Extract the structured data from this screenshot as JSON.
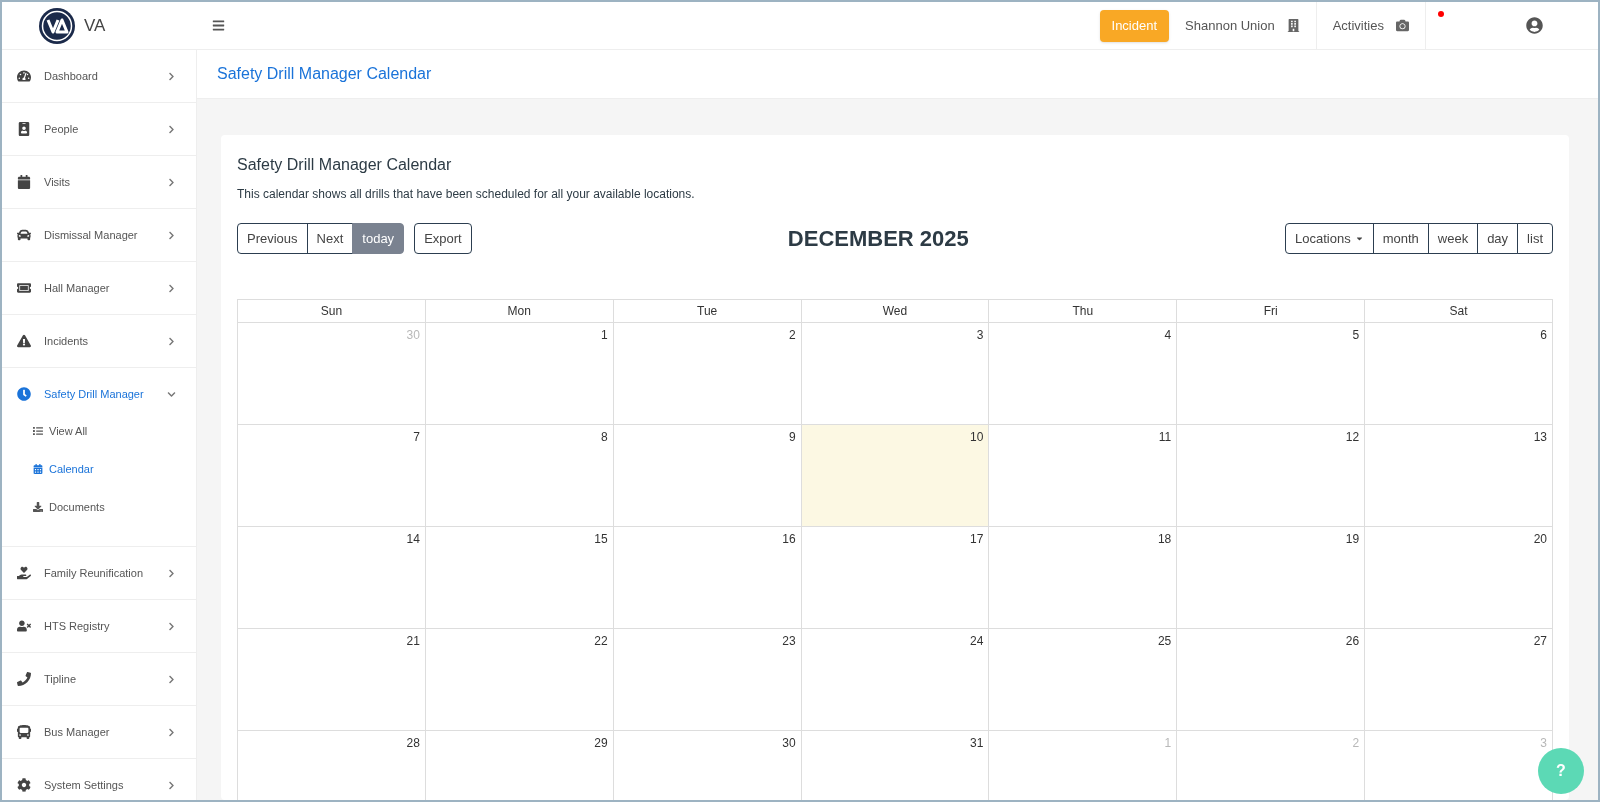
{
  "brand": {
    "name": "VA"
  },
  "topbar": {
    "incident_button": "Incident",
    "school": "Shannon Union",
    "activities": "Activities",
    "has_notification": true
  },
  "sidebar": {
    "items": [
      {
        "label": "Dashboard",
        "selected": false,
        "expanded": false
      },
      {
        "label": "People",
        "selected": false,
        "expanded": false
      },
      {
        "label": "Visits",
        "selected": false,
        "expanded": false
      },
      {
        "label": "Dismissal Manager",
        "selected": false,
        "expanded": false
      },
      {
        "label": "Hall Manager",
        "selected": false,
        "expanded": false
      },
      {
        "label": "Incidents",
        "selected": false,
        "expanded": false
      },
      {
        "label": "Safety Drill Manager",
        "selected": true,
        "expanded": true,
        "children": [
          {
            "label": "View All",
            "selected": false
          },
          {
            "label": "Calendar",
            "selected": true
          },
          {
            "label": "Documents",
            "selected": false
          }
        ]
      },
      {
        "label": "Family Reunification",
        "selected": false,
        "expanded": false
      },
      {
        "label": "HTS Registry",
        "selected": false,
        "expanded": false
      },
      {
        "label": "Tipline",
        "selected": false,
        "expanded": false
      },
      {
        "label": "Bus Manager",
        "selected": false,
        "expanded": false
      },
      {
        "label": "System Settings",
        "selected": false,
        "expanded": false
      }
    ]
  },
  "page_title": "Safety Drill Manager Calendar",
  "card": {
    "title": "Safety Drill Manager Calendar",
    "description": "This calendar shows all drills that have been scheduled for all your available locations."
  },
  "toolbar": {
    "nav_buttons": [
      {
        "label": "Previous",
        "disabled": false
      },
      {
        "label": "Next",
        "disabled": false
      },
      {
        "label": "today",
        "disabled": true
      }
    ],
    "export_button": "Export",
    "heading": "DECEMBER 2025",
    "locations_dropdown": "Locations",
    "view_buttons": [
      {
        "label": "month",
        "selected": false
      },
      {
        "label": "week",
        "selected": false
      },
      {
        "label": "day",
        "selected": false
      },
      {
        "label": "list",
        "selected": false
      }
    ]
  },
  "calendar": {
    "weekdays": [
      "Sun",
      "Mon",
      "Tue",
      "Wed",
      "Thu",
      "Fri",
      "Sat"
    ],
    "weeks": [
      [
        {
          "day": "30",
          "outside": true,
          "today": false
        },
        {
          "day": "1",
          "outside": false,
          "today": false
        },
        {
          "day": "2",
          "outside": false,
          "today": false
        },
        {
          "day": "3",
          "outside": false,
          "today": false
        },
        {
          "day": "4",
          "outside": false,
          "today": false
        },
        {
          "day": "5",
          "outside": false,
          "today": false
        },
        {
          "day": "6",
          "outside": false,
          "today": false
        }
      ],
      [
        {
          "day": "7",
          "outside": false,
          "today": false
        },
        {
          "day": "8",
          "outside": false,
          "today": false
        },
        {
          "day": "9",
          "outside": false,
          "today": false
        },
        {
          "day": "10",
          "outside": false,
          "today": true
        },
        {
          "day": "11",
          "outside": false,
          "today": false
        },
        {
          "day": "12",
          "outside": false,
          "today": false
        },
        {
          "day": "13",
          "outside": false,
          "today": false
        }
      ],
      [
        {
          "day": "14",
          "outside": false,
          "today": false
        },
        {
          "day": "15",
          "outside": false,
          "today": false
        },
        {
          "day": "16",
          "outside": false,
          "today": false
        },
        {
          "day": "17",
          "outside": false,
          "today": false
        },
        {
          "day": "18",
          "outside": false,
          "today": false
        },
        {
          "day": "19",
          "outside": false,
          "today": false
        },
        {
          "day": "20",
          "outside": false,
          "today": false
        }
      ],
      [
        {
          "day": "21",
          "outside": false,
          "today": false
        },
        {
          "day": "22",
          "outside": false,
          "today": false
        },
        {
          "day": "23",
          "outside": false,
          "today": false
        },
        {
          "day": "24",
          "outside": false,
          "today": false
        },
        {
          "day": "25",
          "outside": false,
          "today": false
        },
        {
          "day": "26",
          "outside": false,
          "today": false
        },
        {
          "day": "27",
          "outside": false,
          "today": false
        }
      ],
      [
        {
          "day": "28",
          "outside": false,
          "today": false
        },
        {
          "day": "29",
          "outside": false,
          "today": false
        },
        {
          "day": "30",
          "outside": false,
          "today": false
        },
        {
          "day": "31",
          "outside": false,
          "today": false
        },
        {
          "day": "1",
          "outside": true,
          "today": false
        },
        {
          "day": "2",
          "outside": true,
          "today": false
        },
        {
          "day": "3",
          "outside": true,
          "today": false
        }
      ]
    ]
  },
  "help_button": "?"
}
